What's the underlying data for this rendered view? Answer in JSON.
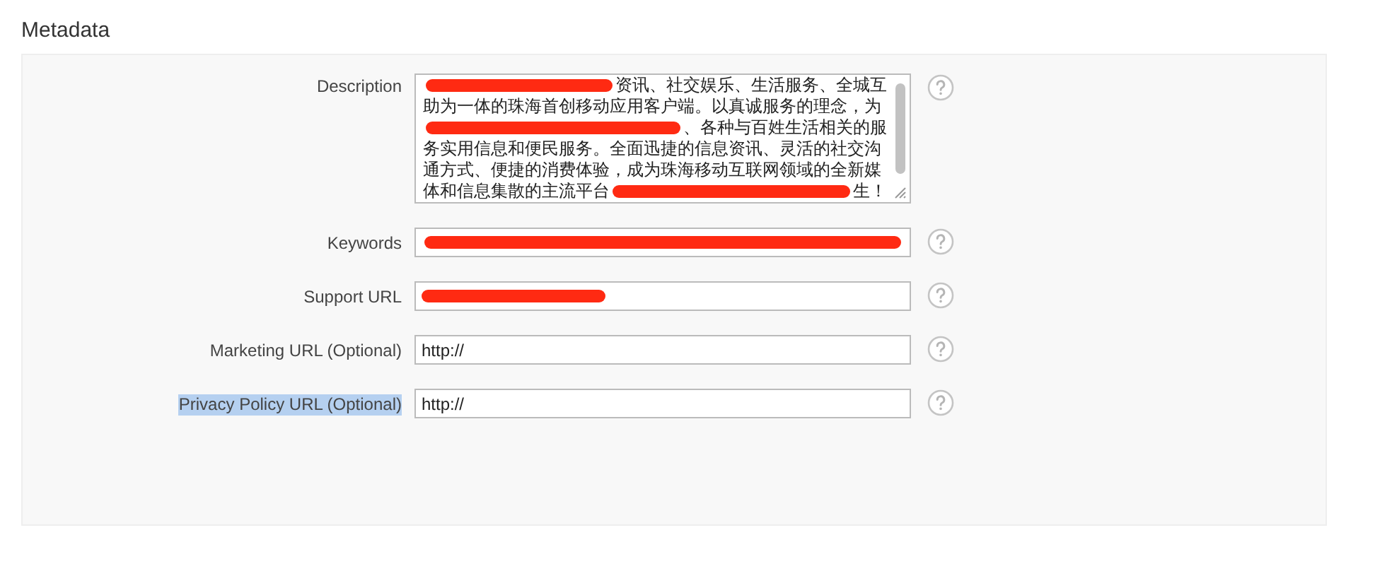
{
  "section_title": "Metadata",
  "fields": [
    {
      "kind": "textarea",
      "label": "Description",
      "highlighted": false,
      "lines": [
        [
          {
            "kind": "redaction"
          },
          {
            "kind": "text",
            "text": "资讯、社交娱乐、生活服务、全城互"
          }
        ],
        [
          {
            "kind": "text",
            "text": "助为一体的珠海首创移动应用客户端。以真诚服务的理念，为"
          }
        ],
        [
          {
            "kind": "redaction"
          },
          {
            "kind": "text",
            "text": "、各种与百姓生活相关的服"
          }
        ],
        [
          {
            "kind": "text",
            "text": "务实用信息和便民服务。全面迅捷的信息资讯、灵活的社交沟"
          }
        ],
        [
          {
            "kind": "text",
            "text": "通方式、便捷的消费体验，成为珠海移动互联网领域的全新媒"
          }
        ],
        [
          {
            "kind": "text",
            "text": "体和信息集散的主流平台"
          },
          {
            "kind": "redaction"
          },
          {
            "kind": "text",
            "text": "生！"
          }
        ]
      ]
    },
    {
      "kind": "input",
      "label": "Keywords",
      "highlighted": false,
      "value": [
        {
          "kind": "redaction"
        }
      ]
    },
    {
      "kind": "input",
      "label": "Support URL",
      "highlighted": false,
      "value": [
        {
          "kind": "redaction-short"
        }
      ]
    },
    {
      "kind": "input",
      "label": "Marketing URL (Optional)",
      "highlighted": false,
      "value": [
        {
          "kind": "text",
          "text": "http://"
        }
      ]
    },
    {
      "kind": "input",
      "label": "Privacy Policy URL (Optional)",
      "highlighted": true,
      "value": [
        {
          "kind": "text",
          "text": "http://"
        }
      ]
    }
  ]
}
